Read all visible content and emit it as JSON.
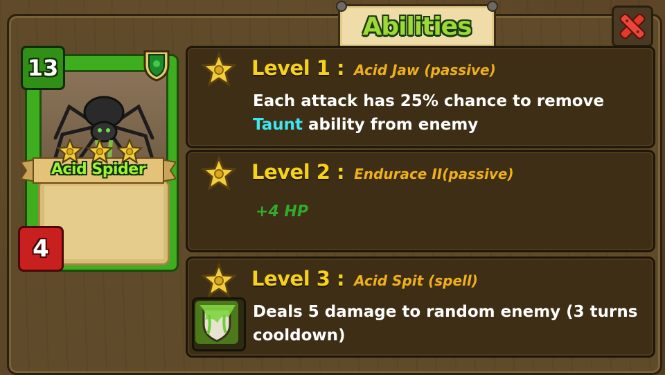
{
  "title": "Abilities",
  "card": {
    "name": "Acid Spider",
    "cost": "13",
    "attack": "4",
    "stars": 3
  },
  "abilities": [
    {
      "level": "Level 1 :",
      "name": "Acid Jaw (passive)",
      "desc_before": "Each attack has 25% chance to remove ",
      "keyword": "Taunt",
      "desc_after": " ability from enemy"
    },
    {
      "level": "Level 2 :",
      "name": "Endurace II(passive)",
      "effect": "+4 HP"
    },
    {
      "level": "Level 3 :",
      "name": "Acid Spit (spell)",
      "desc": "Deals 5 damage to random enemy (3 turns cooldown)"
    }
  ],
  "colors": {
    "title": "#9ed834",
    "level_label": "#f7d21a",
    "ability_name": "#f0b01c",
    "keyword": "#3ee6f2",
    "hp_effect": "#2faa2c",
    "card_frame": "#3fae1e"
  }
}
